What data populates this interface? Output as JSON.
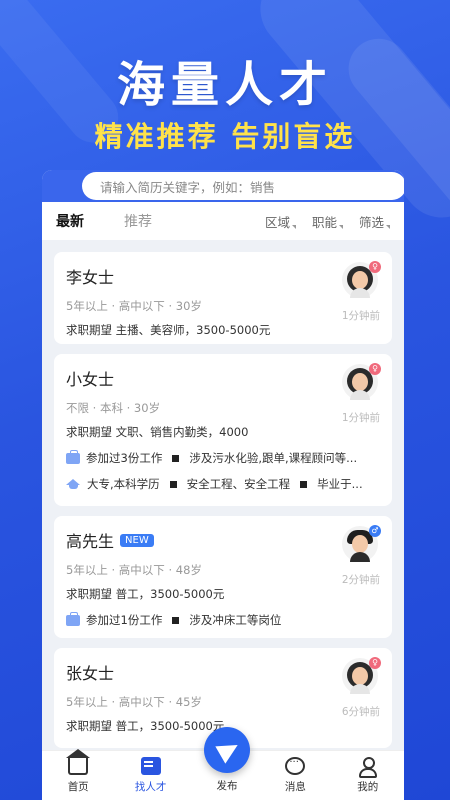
{
  "banner": {
    "headline": "海量人才",
    "subline": "精准推荐  告别盲选"
  },
  "search": {
    "placeholder": "请输入简历关键字，例如：销售"
  },
  "tabs": {
    "latest": "最新",
    "recommend": "推荐"
  },
  "filters": {
    "region": "区域",
    "position": "职能",
    "screen": "筛选"
  },
  "cards": [
    {
      "name": "李女士",
      "meta": "5年以上 · 高中以下 · 30岁",
      "expect": "求职期望 主播、美容师，3500-5000元",
      "time": "1分钟前",
      "gender": "female"
    },
    {
      "name": "小女士",
      "meta": "不限 · 本科 · 30岁",
      "expect": "求职期望 文职、销售内勤类，4000",
      "time": "1分钟前",
      "gender": "female",
      "work": "参加过3份工作",
      "work_detail": "涉及污水化验,跟单,课程顾问等...",
      "edu": "大专,本科学历",
      "edu_detail_1": "安全工程、安全工程",
      "edu_detail_2": "毕业于..."
    },
    {
      "name": "高先生",
      "badge": "NEW",
      "meta": "5年以上 · 高中以下 · 48岁",
      "expect": "求职期望 普工，3500-5000元",
      "time": "2分钟前",
      "gender": "male",
      "work": "参加过1份工作",
      "work_detail": "涉及冲床工等岗位"
    },
    {
      "name": "张女士",
      "meta": "5年以上 · 高中以下 · 45岁",
      "expect": "求职期望 普工，3500-5000元",
      "time": "6分钟前",
      "gender": "female"
    }
  ],
  "tabbar": {
    "home": "首页",
    "talent": "找人才",
    "publish": "发布",
    "message": "消息",
    "mine": "我的"
  },
  "colors": {
    "primary": "#2a55e0",
    "accent_yellow": "#ffe24a",
    "badge_blue": "#3a7cf5",
    "female": "#f06a7c"
  }
}
